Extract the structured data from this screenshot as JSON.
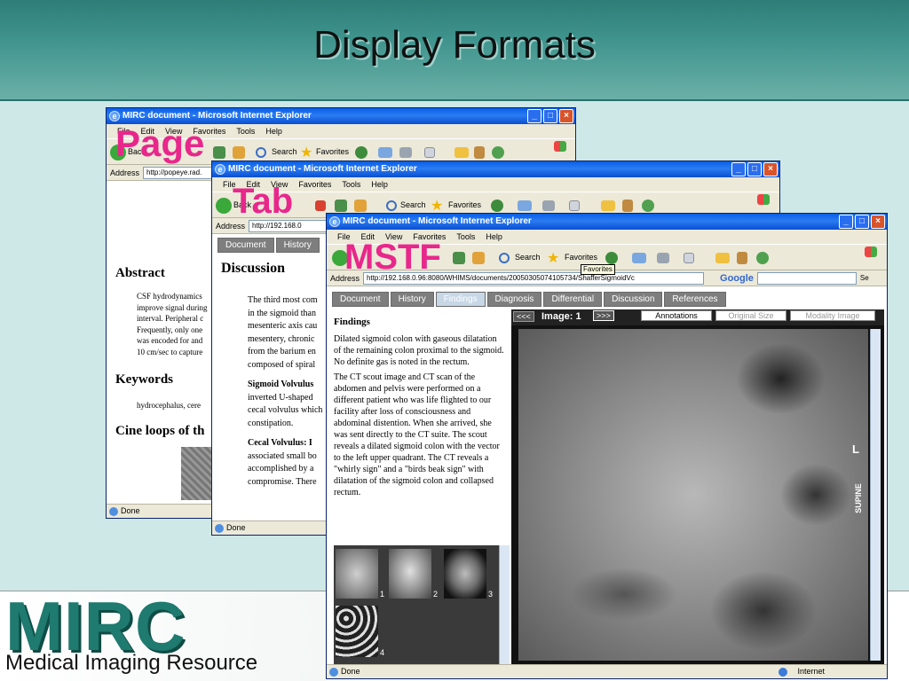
{
  "slide": {
    "title": "Display Formats",
    "logo": "MIRC",
    "logo_subtitle": "Medical Imaging Resource"
  },
  "labels": {
    "page": "Page",
    "tab": "Tab",
    "mstf": "MSTF"
  },
  "window1": {
    "title": "MIRC document - Microsoft Internet Explorer",
    "menu": [
      "File",
      "Edit",
      "View",
      "Favorites",
      "Tools",
      "Help"
    ],
    "back": "Back",
    "search": "Search",
    "favorites": "Favorites",
    "address_label": "Address",
    "address": "http://popeye.rad.",
    "status": "Done",
    "abstract_heading": "Abstract",
    "abstract_lines": [
      "CSF hydrodynamics",
      "improve signal during",
      "interval. Peripheral c",
      "Frequently, only one",
      "was encoded for and",
      "10 cm/sec to capture"
    ],
    "keywords_heading": "Keywords",
    "keywords_text": "hydrocephalus, cere",
    "cine_heading": "Cine loops of th"
  },
  "window2": {
    "title": "MIRC document - Microsoft Internet Explorer",
    "menu": [
      "File",
      "Edit",
      "View",
      "Favorites",
      "Tools",
      "Help"
    ],
    "back": "Back",
    "search": "Search",
    "favorites": "Favorites",
    "address_label": "Address",
    "address": "http://192.168.0",
    "status": "Done",
    "tabs": [
      "Document",
      "History"
    ],
    "discussion_heading": "Discussion",
    "para1": [
      "The third most com",
      "in the sigmoid than",
      "mesenteric axis cau",
      "mesentery, chronic",
      "from the barium en",
      "composed of spiral"
    ],
    "sig_heading": "Sigmoid Volvulus",
    "para2": [
      "inverted U-shaped",
      "cecal volvulus which",
      "constipation."
    ],
    "cecal_heading": "Cecal Volvulus: I",
    "para3": [
      "associated small bo",
      "accomplished by a",
      "compromise. There"
    ]
  },
  "window3": {
    "title": "MIRC document - Microsoft Internet Explorer",
    "menu": [
      "File",
      "Edit",
      "View",
      "Favorites",
      "Tools",
      "Help"
    ],
    "search": "Search",
    "favorites": "Favorites",
    "favorites_tooltip": "Favorites",
    "address_label": "Address",
    "address": "http://192.168.0.96:8080/WHIMS/documents/20050305074105734/ShafferSigmoidVc",
    "google": "Google",
    "go_label": "Se",
    "status": "Done",
    "status_zone": "Internet",
    "tabs": [
      "Document",
      "History",
      "Findings",
      "Diagnosis",
      "Differential",
      "Discussion",
      "References"
    ],
    "active_tab": "Findings",
    "findings_heading": "Findings",
    "findings_p1": "Dilated sigmoid colon with gaseous dilatation of the remaining colon proximal to the sigmoid. No definite gas is noted in the rectum.",
    "findings_p2": "The CT scout image and CT scan of the abdomen and pelvis were performed on a different patient who was life flighted to our facility after loss of consciousness and abdominal distention. When she arrived, she was sent directly to the CT suite. The scout reveals a dilated sigmoid colon with the vector to the left upper quadrant. The CT reveals a \"whirly sign\" and a \"birds beak sign\" with dilatation of the sigmoid colon and collapsed rectum.",
    "prev_btn": "<<<",
    "image_label": "Image: 1",
    "next_btn": ">>>",
    "annotations_btn": "Annotations",
    "original_size_btn": "Original Size",
    "modality_btn": "Modality Image",
    "xray_marker": "L",
    "xray_position": "SUPINE",
    "thumbs": [
      "1",
      "2",
      "3",
      "4"
    ]
  }
}
